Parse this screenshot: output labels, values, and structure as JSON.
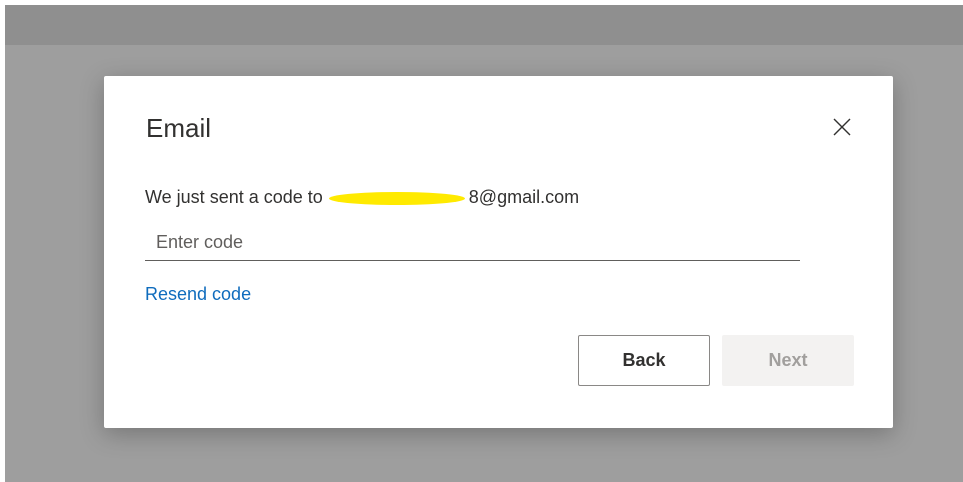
{
  "dialog": {
    "title": "Email",
    "close_icon": "close-icon",
    "message_prefix": "We just sent a code to",
    "email_suffix": "8@gmail.com",
    "code_input": {
      "value": "",
      "placeholder": "Enter code"
    },
    "resend_label": "Resend code",
    "back_label": "Back",
    "next_label": "Next"
  },
  "colors": {
    "link": "#0f6cbd",
    "redaction": "#ffea00",
    "disabled_bg": "#f3f2f1",
    "overlay": "#9e9e9e"
  }
}
